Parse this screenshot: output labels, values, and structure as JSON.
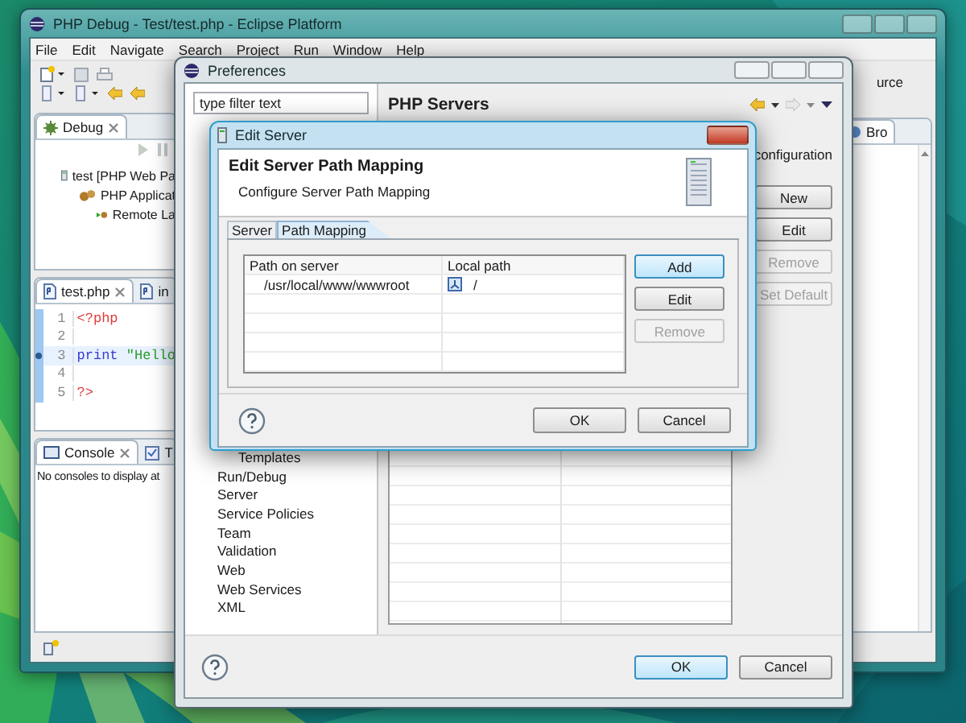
{
  "eclipse": {
    "title": "PHP Debug - Test/test.php - Eclipse Platform",
    "menu": [
      "File",
      "Edit",
      "Navigate",
      "Search",
      "Project",
      "Run",
      "Window",
      "Help"
    ],
    "perspective": "urce",
    "debug_view": {
      "tab": "Debug",
      "tree": [
        {
          "label": "test [PHP Web Pa",
          "kind": "launch",
          "children": [
            {
              "label": "PHP Applicat",
              "kind": "application",
              "children": [
                {
                  "label": "Remote La",
                  "kind": "target"
                }
              ]
            }
          ]
        }
      ]
    },
    "editor": {
      "tabs": [
        {
          "label": "test.php",
          "selected": true
        },
        {
          "label": "in",
          "selected": false
        }
      ],
      "lines": [
        {
          "number": "1",
          "current": false,
          "breakpoint": false,
          "tokens": [
            {
              "kind": "tag",
              "text": "<?php"
            }
          ]
        },
        {
          "number": "2",
          "current": false,
          "breakpoint": false
        },
        {
          "number": "3",
          "current": true,
          "breakpoint": true,
          "tokens": [
            {
              "kind": "keyword",
              "text": "print"
            },
            {
              "kind": "string",
              "text": "\"Hello"
            }
          ]
        },
        {
          "number": "4",
          "current": false,
          "breakpoint": false
        },
        {
          "number": "5",
          "current": false,
          "breakpoint": false,
          "tokens": [
            {
              "kind": "tag",
              "text": "?>"
            }
          ]
        }
      ]
    },
    "console": {
      "tabs": [
        {
          "label": "Console",
          "selected": true
        },
        {
          "label": "T",
          "selected": false
        }
      ],
      "message": "No consoles to display at"
    },
    "side_view": {
      "tab": "Bro"
    }
  },
  "preferences": {
    "title": "Preferences",
    "filter": {
      "placeholder": "type filter text"
    },
    "tree": [
      {
        "children": [
          {
            "label": "Templates"
          }
        ]
      },
      {
        "label": "Run/Debug"
      },
      {
        "label": "Server"
      },
      {
        "label": "Service Policies"
      },
      {
        "label": "Team"
      },
      {
        "label": "Validation"
      },
      {
        "label": "Web"
      },
      {
        "label": "Web Services"
      },
      {
        "label": "XML"
      }
    ],
    "heading": "PHP Servers",
    "description": "configuration",
    "buttons": [
      {
        "label": "New",
        "disabled": false
      },
      {
        "label": "Edit",
        "disabled": false
      },
      {
        "label": "Remove",
        "disabled": true
      },
      {
        "label": "Set Default",
        "disabled": true
      }
    ],
    "footer_buttons": [
      {
        "label": "OK",
        "default": true
      },
      {
        "label": "Cancel",
        "default": false
      }
    ]
  },
  "edit_server": {
    "title": "Edit Server",
    "heading": "Edit Server Path Mapping",
    "description": "Configure Server Path Mapping",
    "tabs": [
      {
        "label": "Server",
        "selected": false
      },
      {
        "label": "Path Mapping",
        "selected": true
      }
    ],
    "table": {
      "columns": [
        "Path on server",
        "Local path"
      ],
      "rows": [
        {
          "path": "/usr/local/www/wwwroot",
          "local_path": "/"
        }
      ]
    },
    "buttons": [
      {
        "label": "Add",
        "default": true,
        "disabled": false
      },
      {
        "label": "Edit",
        "default": false,
        "disabled": false
      },
      {
        "label": "Remove",
        "default": false,
        "disabled": true
      }
    ],
    "footer_buttons": [
      {
        "label": "OK",
        "default": false
      },
      {
        "label": "Cancel",
        "default": false
      }
    ]
  }
}
